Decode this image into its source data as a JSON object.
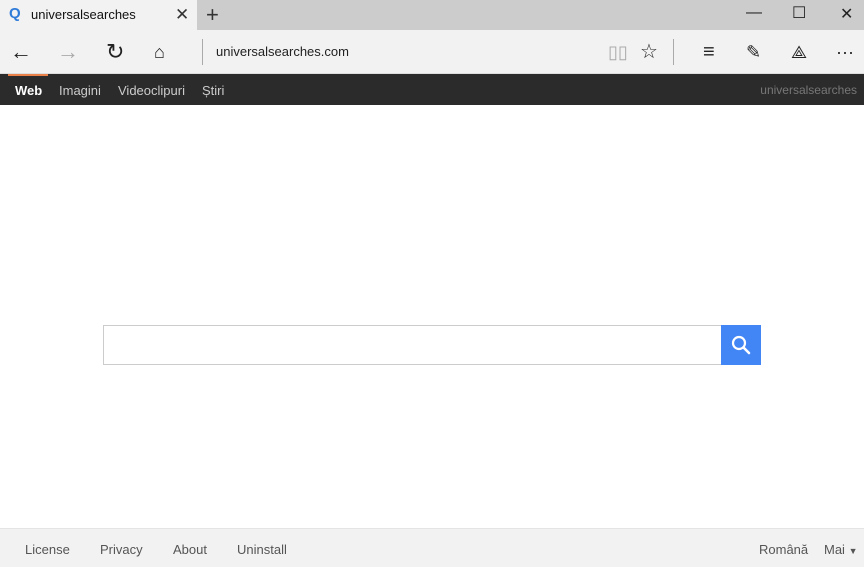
{
  "browser": {
    "tab_title": "universalsearches",
    "url": "universalsearches.com"
  },
  "nav": {
    "items": [
      "Web",
      "Imagini",
      "Videoclipuri",
      "Știri"
    ],
    "brand": "universalsearches"
  },
  "search": {
    "placeholder": "",
    "value": "",
    "accent": "#4285f4"
  },
  "footer": {
    "links": [
      "License",
      "Privacy",
      "About",
      "Uninstall"
    ],
    "language": "Română",
    "more": "Mai"
  }
}
